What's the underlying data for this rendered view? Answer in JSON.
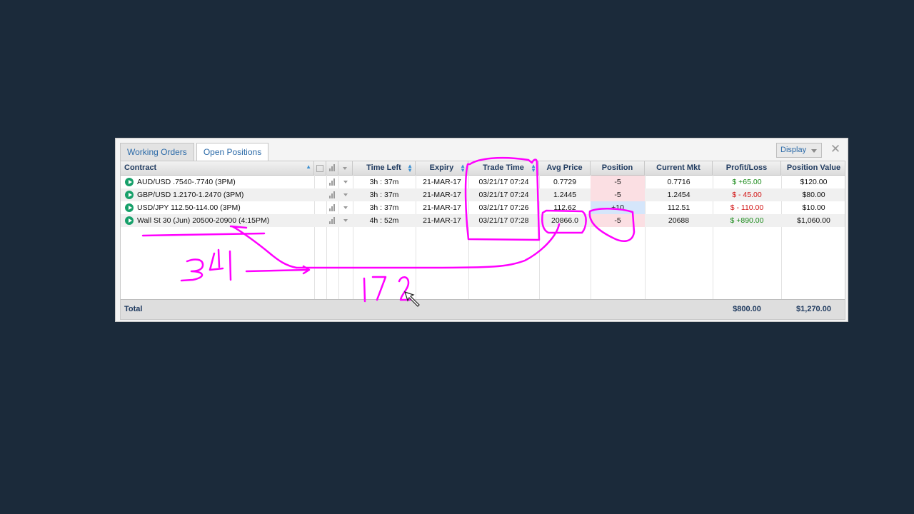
{
  "tabs": [
    {
      "label": "Working Orders",
      "active": false
    },
    {
      "label": "Open Positions",
      "active": true
    }
  ],
  "display_label": "Display",
  "close_glyph": "✕",
  "columns": {
    "contract": "Contract",
    "time_left": "Time Left",
    "expiry": "Expiry",
    "trade_time": "Trade Time",
    "avg_price": "Avg Price",
    "position": "Position",
    "current_mkt": "Current Mkt",
    "profit_loss": "Profit/Loss",
    "position_value": "Position Value"
  },
  "rows": [
    {
      "contract": "AUD/USD .7540-.7740 (3PM)",
      "time_left": "3h : 37m",
      "expiry": "21-MAR-17",
      "trade_time": "03/21/17 07:24",
      "avg_price": "0.7729",
      "position": "-5",
      "current_mkt": "0.7716",
      "profit_loss": "$ +65.00",
      "pl_sign": "gain",
      "position_value": "$120.00"
    },
    {
      "contract": "GBP/USD 1.2170-1.2470 (3PM)",
      "time_left": "3h : 37m",
      "expiry": "21-MAR-17",
      "trade_time": "03/21/17 07:24",
      "avg_price": "1.2445",
      "position": "-5",
      "current_mkt": "1.2454",
      "profit_loss": "$ - 45.00",
      "pl_sign": "loss",
      "position_value": "$80.00"
    },
    {
      "contract": "USD/JPY 112.50-114.00 (3PM)",
      "time_left": "3h : 37m",
      "expiry": "21-MAR-17",
      "trade_time": "03/21/17 07:26",
      "avg_price": "112.62",
      "position": "+10",
      "current_mkt": "112.51",
      "profit_loss": "$ - 110.00",
      "pl_sign": "loss",
      "position_value": "$10.00"
    },
    {
      "contract": "Wall St 30 (Jun) 20500-20900 (4:15PM)",
      "time_left": "4h : 52m",
      "expiry": "21-MAR-17",
      "trade_time": "03/21/17 07:28",
      "avg_price": "20866.0",
      "position": "-5",
      "current_mkt": "20688",
      "profit_loss": "$ +890.00",
      "pl_sign": "gain",
      "position_value": "$1,060.00"
    }
  ],
  "total": {
    "label": "Total",
    "profit_loss": "$800.00",
    "position_value": "$1,270.00"
  },
  "annotations": {
    "handwritten_1": "34",
    "handwritten_2": "172",
    "color": "#ff00ff"
  }
}
